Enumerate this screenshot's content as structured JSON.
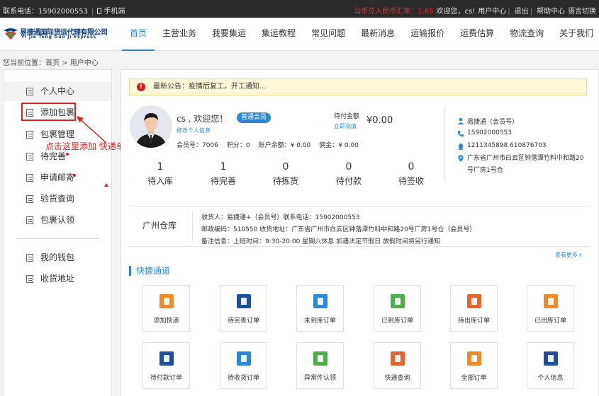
{
  "topbar": {
    "phone_label": "联系电话：15902000553",
    "mobile_label": "手机端",
    "exchange_rate": "马币兑人民币汇率：1.65",
    "greeting": "欢迎您，cs!",
    "user_center": "用户中心",
    "logout": "退出",
    "help_center": "帮助中心",
    "language": "语言切换"
  },
  "logo": {
    "cn": "易捷通国际货运代理有限公司",
    "en": "Yi Jie Tong Guo Ji Express"
  },
  "nav": [
    "首页",
    "主营业务",
    "我要集运",
    "集运教程",
    "常见问题",
    "最新消息",
    "运输报价",
    "运费估算",
    "物流查询",
    "关于我们"
  ],
  "breadcrumb": "您当前位置：首页 > 用户中心",
  "sidebar": {
    "items": [
      "个人中心",
      "添加包裹",
      "包裹管理",
      "待完善",
      "申请邮寄",
      "验货查询",
      "包裹认领",
      "我的钱包",
      "收货地址"
    ]
  },
  "annotation": {
    "text": "点击这里添加 快递单号"
  },
  "notice": {
    "icon": "alert-icon",
    "text": "最新公告：疫情后复工，开工通知..."
  },
  "profile": {
    "welcome": "cs , 欢迎您！",
    "badge": "普通会员",
    "edit_link": "修改个人信息",
    "member_no": "会员号：7006",
    "points": "积分：0",
    "balance": "账户余额：¥ 0.00",
    "commission": "佣金：¥ 0.00"
  },
  "payment": {
    "label": "待付金额",
    "recharge": "立即充值",
    "amount": "¥0.00"
  },
  "counts": [
    {
      "num": "1",
      "label": "待入库"
    },
    {
      "num": "1",
      "label": "待完善"
    },
    {
      "num": "0",
      "label": "待拣货"
    },
    {
      "num": "0",
      "label": "待付款"
    },
    {
      "num": "0",
      "label": "待签收"
    }
  ],
  "contact": {
    "name": "易捷通（会员号）",
    "phone": "15902000553",
    "qq": "1211345898  610876703",
    "address": "广东省广州市白云区钟落潭竹料中和路20号厂房1号仓",
    "colors": {
      "icon": "#2b88d8"
    }
  },
  "warehouse": {
    "title": "广州仓库",
    "line1": "收货人：易捷通+（会员号）联系电话：15902000553",
    "line2": "邮政编码：510550                     收货地址：广东省广州市白云区钟落潭竹料中和路20号厂房1号仓（会员号）",
    "line3": "备注信息：上班时间：9:30-20:00 星期六休息 如遇法定节假日 放假时间将另行通知",
    "more": "查看更多+"
  },
  "quick": {
    "title": "快捷通道",
    "tiles": [
      {
        "label": "添加快递",
        "color": "#f08a24",
        "icon": "add-express-icon"
      },
      {
        "label": "待完善订单",
        "color": "#1f4f9c",
        "icon": "pending-complete-icon"
      },
      {
        "label": "未到库订单",
        "color": "#2b88d8",
        "icon": "not-arrived-icon"
      },
      {
        "label": "已到库订单",
        "color": "#4cae4c",
        "icon": "arrived-icon"
      },
      {
        "label": "待出库订单",
        "color": "#e4642c",
        "icon": "pending-out-icon"
      },
      {
        "label": "已出库订单",
        "color": "#f08a24",
        "icon": "shipped-icon"
      },
      {
        "label": "待付款订单",
        "color": "#1f4f9c",
        "icon": "pending-pay-icon"
      },
      {
        "label": "待收货订单",
        "color": "#2b88d8",
        "icon": "pending-receive-icon"
      },
      {
        "label": "异常件认领",
        "color": "#4cae4c",
        "icon": "exception-claim-icon"
      },
      {
        "label": "快递查询",
        "color": "#e4642c",
        "icon": "express-query-icon"
      },
      {
        "label": "全部订单",
        "color": "#f08a24",
        "icon": "all-orders-icon"
      },
      {
        "label": "个人信息",
        "color": "#1f4f9c",
        "icon": "personal-info-icon"
      }
    ]
  }
}
